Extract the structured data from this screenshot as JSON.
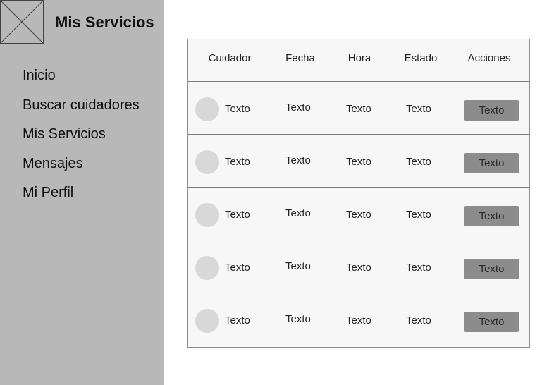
{
  "app": {
    "title": "Mis Servicios",
    "logo_icon": "image-placeholder-icon"
  },
  "sidebar": {
    "items": [
      {
        "label": "Inicio"
      },
      {
        "label": "Buscar cuidadores"
      },
      {
        "label": "Mis Servicios"
      },
      {
        "label": "Mensajes"
      },
      {
        "label": "Mi Perfil"
      }
    ]
  },
  "table": {
    "columns": [
      "Cuidador",
      "Fecha",
      "Hora",
      "Estado",
      "Acciones"
    ],
    "rows": [
      {
        "cuidador": "Texto",
        "fecha": "Texto",
        "hora": "Texto",
        "estado": "Texto",
        "accion": "Texto"
      },
      {
        "cuidador": "Texto",
        "fecha": "Texto",
        "hora": "Texto",
        "estado": "Texto",
        "accion": "Texto"
      },
      {
        "cuidador": "Texto",
        "fecha": "Texto",
        "hora": "Texto",
        "estado": "Texto",
        "accion": "Texto"
      },
      {
        "cuidador": "Texto",
        "fecha": "Texto",
        "hora": "Texto",
        "estado": "Texto",
        "accion": "Texto"
      },
      {
        "cuidador": "Texto",
        "fecha": "Texto",
        "hora": "Texto",
        "estado": "Texto",
        "accion": "Texto"
      }
    ]
  },
  "colors": {
    "sidebar_bg": "#b8b8b8",
    "button_bg": "#8c8c8c",
    "avatar_bg": "#d8d8d8"
  }
}
